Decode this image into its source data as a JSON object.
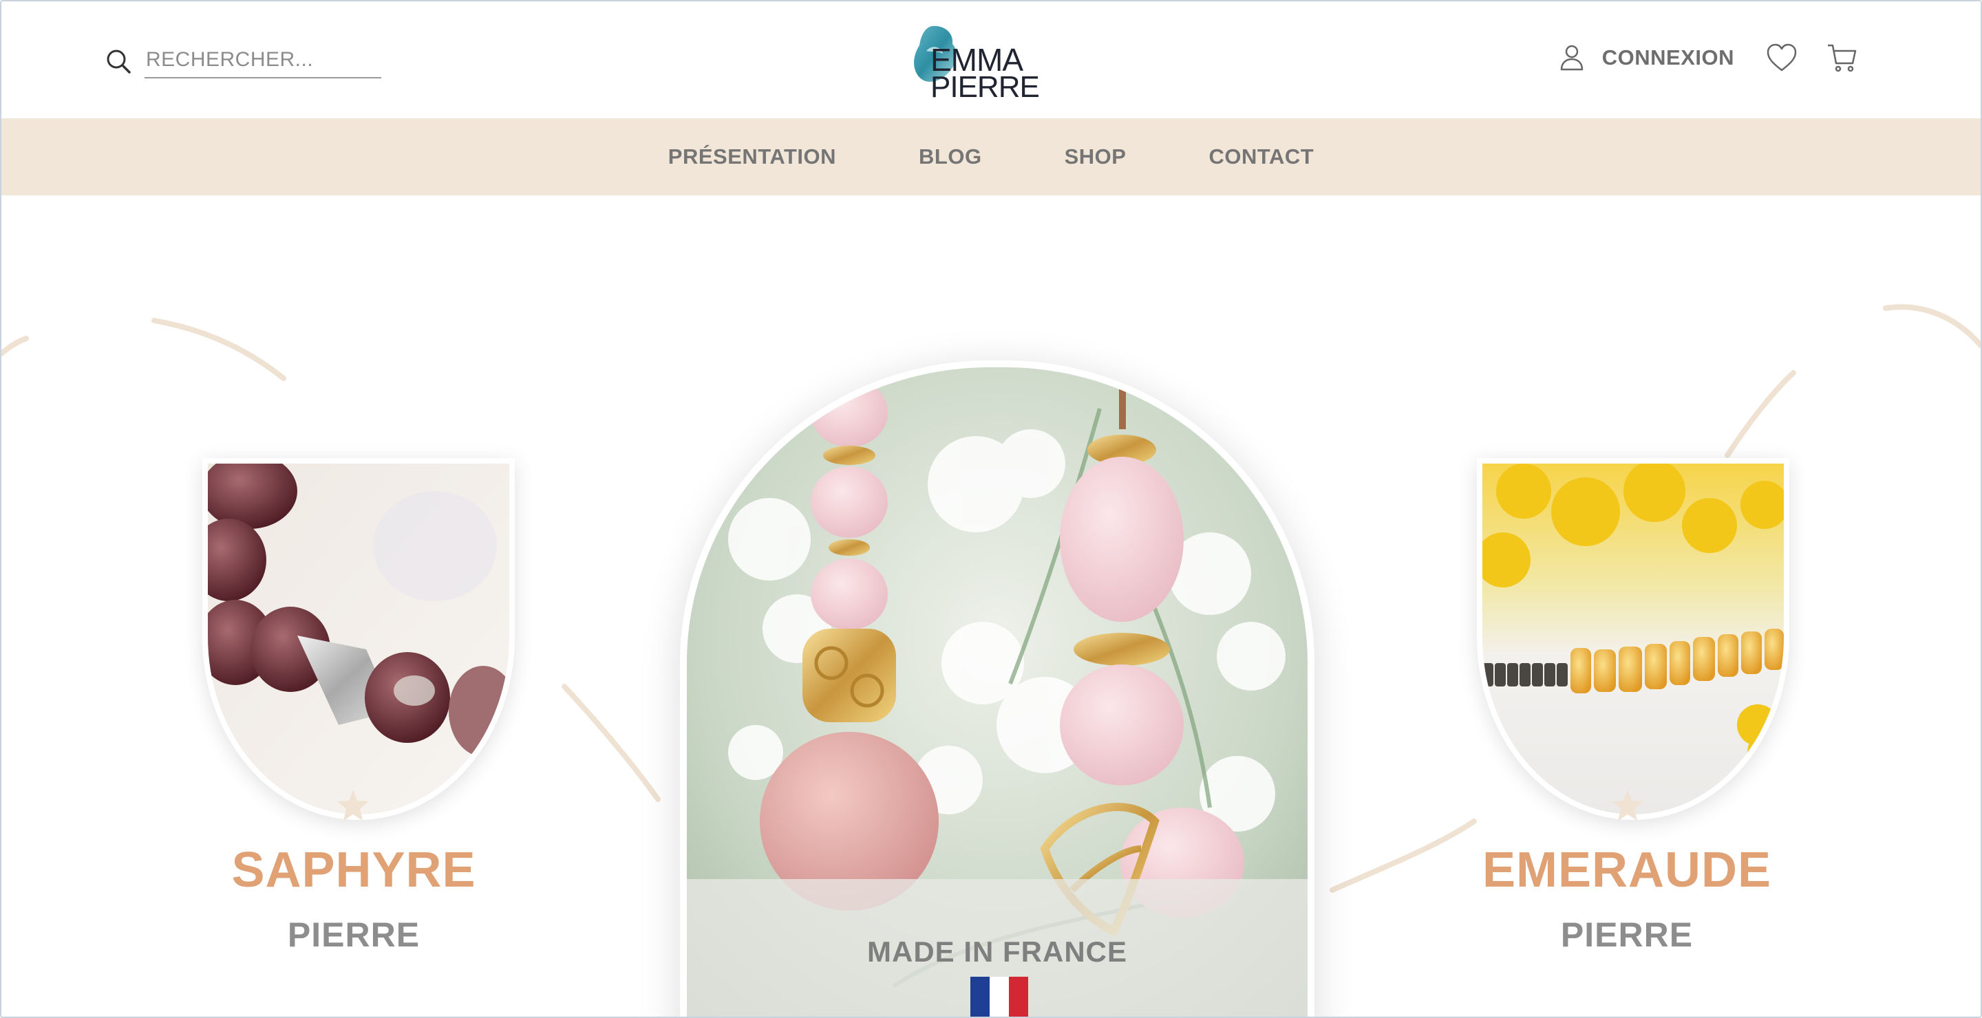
{
  "header": {
    "search_placeholder": "RECHERCHER...",
    "logo_line1": "EMMA",
    "logo_line2": "PIERRE",
    "login_label": "CONNEXION"
  },
  "menu": {
    "items": [
      "PRÉSENTATION",
      "BLOG",
      "SHOP",
      "CONTACT"
    ]
  },
  "hero": {
    "left": {
      "title": "SAPHYRE",
      "subtitle": "PIERRE"
    },
    "right": {
      "title": "EMERAUDE",
      "subtitle": "PIERRE"
    },
    "center": {
      "banner": "MADE IN FRANCE"
    }
  },
  "colors": {
    "menu_bg": "#f2e6d8",
    "accent": "#e0a275",
    "text_grey": "#757575",
    "flag_blue": "#1f3f95",
    "flag_white": "#ffffff",
    "flag_red": "#d32733"
  },
  "icons": [
    "search-icon",
    "user-icon",
    "heart-icon",
    "cart-icon",
    "star-icon",
    "france-flag-icon"
  ]
}
